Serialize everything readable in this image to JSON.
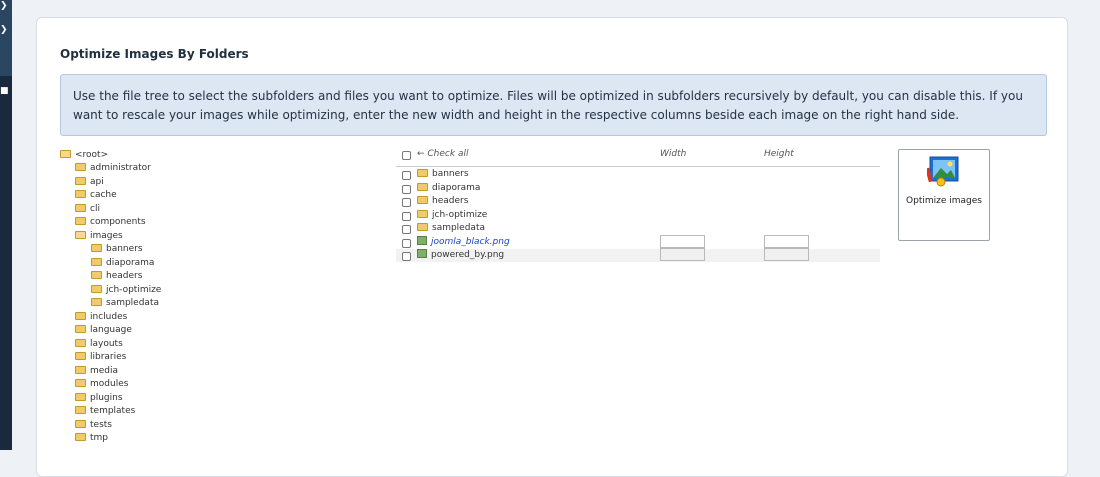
{
  "section": {
    "title": "Optimize Images By Folders",
    "info": "Use the file tree to select the subfolders and files you want to optimize. Files will be optimized in subfolders recursively by default, you can disable this. If you want to rescale your images while optimizing, enter the new width and height in the respective columns beside each image on the right hand side."
  },
  "tree": {
    "root": "<root>",
    "items": [
      "administrator",
      "api",
      "cache",
      "cli",
      "components",
      "images",
      "includes",
      "language",
      "layouts",
      "libraries",
      "media",
      "modules",
      "plugins",
      "templates",
      "tests",
      "tmp"
    ],
    "images_children": [
      "banners",
      "diaporama",
      "headers",
      "jch-optimize",
      "sampledata"
    ]
  },
  "files": {
    "header": {
      "check_all": "← Check all",
      "width": "Width",
      "height": "Height"
    },
    "folders": [
      "banners",
      "diaporama",
      "headers",
      "jch-optimize",
      "sampledata"
    ],
    "images": [
      {
        "name": "joomla_black.png",
        "width": "",
        "height": ""
      },
      {
        "name": "powered_by.png",
        "width": "",
        "height": ""
      }
    ]
  },
  "optimize_button": {
    "label": "Optimize images"
  },
  "colors": {
    "accent": "#1b44c8",
    "info_bg": "#dde6f3",
    "sidebar": "#1a2a3c"
  }
}
